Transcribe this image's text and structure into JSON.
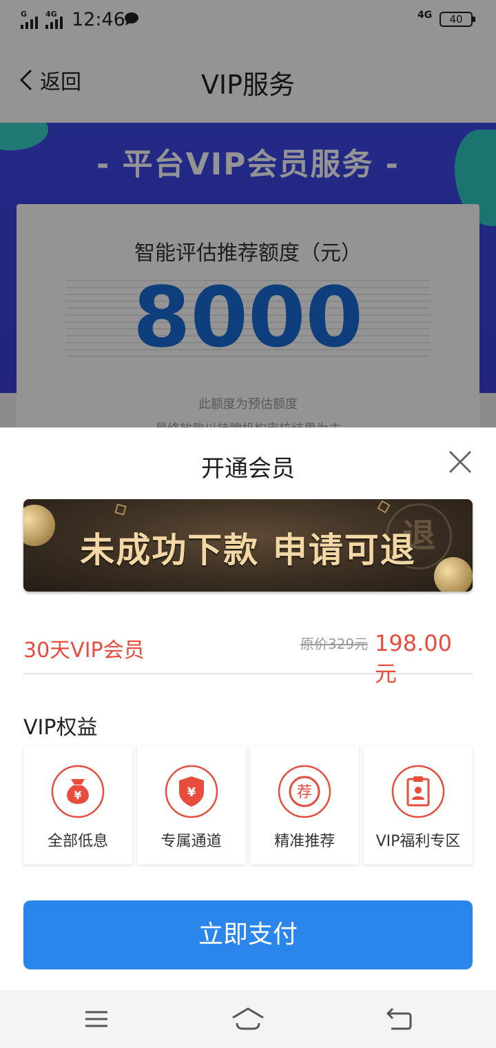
{
  "status_bar": {
    "time": "12:46",
    "signal_label": "G",
    "signal2_label": "4G",
    "network_label": "4G",
    "battery": "40"
  },
  "nav": {
    "back_label": "返回",
    "title": "VIP服务"
  },
  "hero": {
    "heading": "- 平台VIP会员服务 -",
    "card_label": "智能评估推荐额度（元）",
    "amount": "8000",
    "note_1": "此额度为预估额度",
    "note_2": "最终放款以持牌机构审核结果为主"
  },
  "sheet": {
    "title": "开通会员",
    "banner_slogan": "未成功下款 申请可退",
    "banner_badge": "退",
    "plan": {
      "name": "30天VIP会员",
      "original_price": "原价329元",
      "price": "198.00元"
    },
    "benefits_title": "VIP权益",
    "benefits": [
      {
        "label": "全部低息",
        "icon": "money-bag-icon"
      },
      {
        "label": "专属通道",
        "icon": "shield-yen-icon"
      },
      {
        "label": "精准推荐",
        "icon": "recommend-badge-icon"
      },
      {
        "label": "VIP福利专区",
        "icon": "clipboard-user-icon"
      }
    ],
    "pay_label": "立即支付"
  },
  "colors": {
    "accent_red": "#e74c3c",
    "pay_blue": "#2b86ec",
    "hero_blue": "#3d49e6",
    "amount_blue": "#1b6bd6"
  }
}
